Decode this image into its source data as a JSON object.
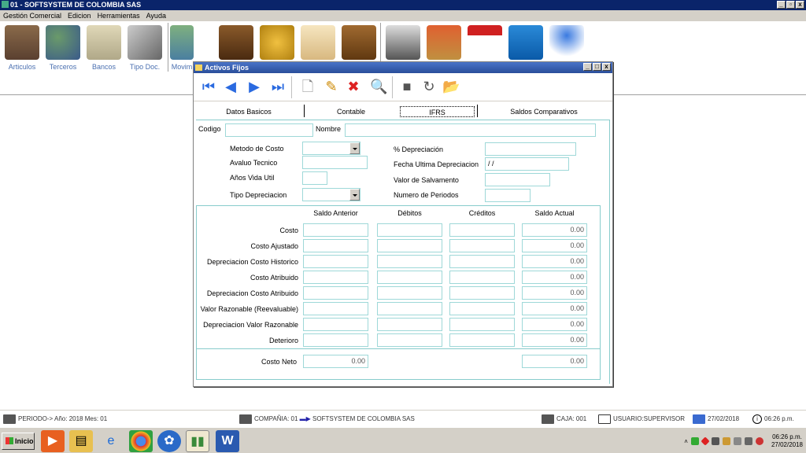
{
  "app": {
    "title": "01 - SOFTSYSTEM DE COLOMBIA SAS"
  },
  "menu": [
    "Gestión Comercial",
    "Edicion",
    "Herramientas",
    "Ayuda"
  ],
  "toolbar": {
    "items": [
      "Articulos",
      "Terceros",
      "Bancos",
      "Tipo Doc.",
      "Movim"
    ]
  },
  "window": {
    "title": "Activos Fijos"
  },
  "tabs": [
    "Datos Basicos",
    "Contable",
    "IFRS",
    "Saldos Comparativos"
  ],
  "tab_active": "IFRS",
  "form": {
    "codigo_label": "Codigo",
    "nombre_label": "Nombre",
    "metodo_costo": "Metodo de Costo",
    "avaluo_tecnico": "Avaluo Tecnico",
    "anos_vida_util": "Años Vida Util",
    "tipo_depreciacion": "Tipo Depreciacion",
    "pct_depreciacion": "% Depreciación",
    "fecha_ultima": "Fecha Ultima Depreciacion",
    "fecha_ultima_value": " / /",
    "valor_salvamento": "Valor de Salvamento",
    "numero_periodos": "Numero de Periodos"
  },
  "table": {
    "headers": [
      "Saldo Anterior",
      "Débitos",
      "Créditos",
      "Saldo Actual"
    ],
    "rows": [
      {
        "label": "Costo",
        "saldo_actual": "0.00"
      },
      {
        "label": "Costo Ajustado",
        "saldo_actual": "0.00"
      },
      {
        "label": "Depreciacion Costo Historico",
        "saldo_actual": "0.00"
      },
      {
        "label": "Costo Atribuido",
        "saldo_actual": "0.00"
      },
      {
        "label": "Depreciacion Costo Atribuido",
        "saldo_actual": "0.00"
      },
      {
        "label": "Valor Razonable (Reevaluable)",
        "saldo_actual": "0.00"
      },
      {
        "label": "Depreciacion Valor Razonable",
        "saldo_actual": "0.00"
      },
      {
        "label": "Deterioro",
        "saldo_actual": "0.00"
      }
    ],
    "costo_neto": {
      "label": "Costo Neto",
      "saldo_anterior": "0.00",
      "saldo_actual": "0.00"
    }
  },
  "status": {
    "periodo": "PERIODO-> Año: 2018  Mes: 01",
    "compania": "COMPAÑIA: 01",
    "compania_name": "SOFTSYSTEM DE COLOMBIA SAS",
    "caja": "CAJA: 001",
    "usuario": "USUARIO:SUPERVISOR",
    "fecha": "27/02/2018",
    "hora": "06:26 p.m."
  },
  "taskbar": {
    "start": "Inicio",
    "clock_time": "06:26 p.m.",
    "clock_date": "27/02/2018"
  },
  "colors": {
    "title_bg": "#0a246a",
    "field_border": "#9ed8d8",
    "link_blue": "#4a6fb0"
  }
}
